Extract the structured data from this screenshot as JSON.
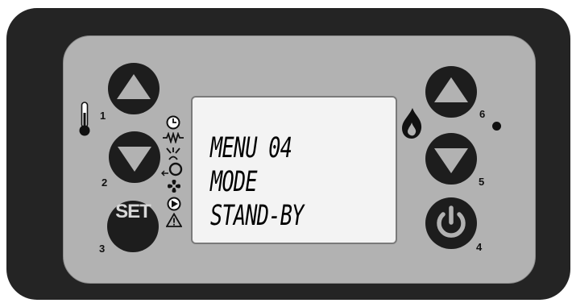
{
  "display": {
    "lines": [
      "MENU 04",
      "MODE",
      "STAND-BY"
    ]
  },
  "buttons": {
    "up_left_number": "1",
    "down_left_number": "2",
    "set_number": "3",
    "power_number": "4",
    "down_right_number": "5",
    "up_right_number": "6",
    "set_label": "SET"
  },
  "status_icons": [
    "clock-icon",
    "heater-icon",
    "igniter-icon",
    "pump-icon",
    "fan-icon",
    "motor-icon",
    "warning-icon"
  ],
  "colors": {
    "housing": "#242424",
    "faceplate": "#b2b2b2",
    "button": "#1d1d1d",
    "lcd": "#f3f3f3"
  }
}
